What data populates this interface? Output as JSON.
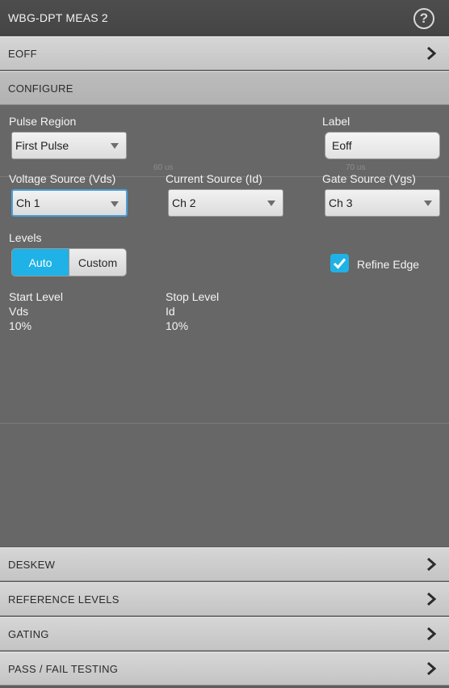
{
  "title_bar": {
    "title": "WBG-DPT MEAS 2",
    "help_icon": "help-icon"
  },
  "sections": {
    "eoff": "EOFF",
    "configure": "CONFIGURE",
    "deskew": "DESKEW",
    "reference_levels": "REFERENCE LEVELS",
    "gating": "GATING",
    "pass_fail": "PASS / FAIL TESTING"
  },
  "background_ticks": {
    "t1": "60 us",
    "t2": "70 us"
  },
  "configure": {
    "pulse_region": {
      "label": "Pulse Region",
      "value": "First Pulse"
    },
    "label_field": {
      "label": "Label",
      "value": "Eoff"
    },
    "voltage_source": {
      "label": "Voltage Source (Vds)",
      "value": "Ch 1"
    },
    "current_source": {
      "label": "Current Source (Id)",
      "value": "Ch 2"
    },
    "gate_source": {
      "label": "Gate Source (Vgs)",
      "value": "Ch 3"
    },
    "levels": {
      "label": "Levels",
      "auto": "Auto",
      "custom": "Custom",
      "selected": "Auto"
    },
    "refine_edge": {
      "label": "Refine Edge",
      "checked": true
    },
    "start_level": {
      "label": "Start Level",
      "source": "Vds",
      "value": "10%"
    },
    "stop_level": {
      "label": "Stop Level",
      "source": "Id",
      "value": "10%"
    }
  },
  "colors": {
    "accent": "#1fb2e6",
    "header_bg": "#c8c8c8",
    "panel_bg": "#676767"
  }
}
